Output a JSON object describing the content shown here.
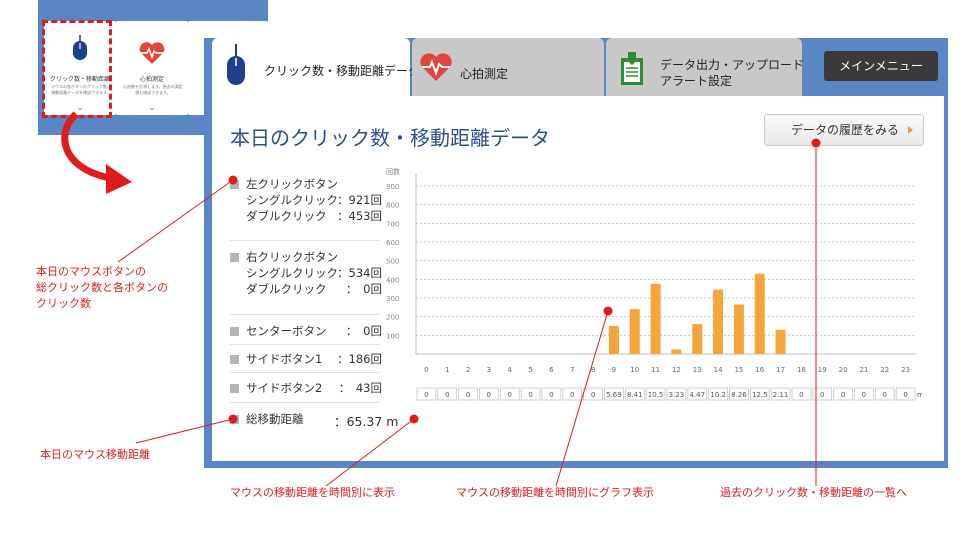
{
  "mini": {
    "cards": [
      {
        "title": "クリック数・移動距離",
        "desc": "マウスの各ボタンのクリック数、移動距離データを確認できます。"
      },
      {
        "title": "心拍測定",
        "desc": "心拍数を計測します。過去の測定値も確認できます。"
      },
      {
        "title": "",
        "desc": ""
      }
    ]
  },
  "tabs": [
    {
      "label": "クリック数・移動距離データ",
      "icon": "mouse-icon"
    },
    {
      "label": "心拍測定",
      "icon": "heart-pulse-icon"
    },
    {
      "label_line1": "データ出力・アップロード",
      "label_line2": "アラート設定",
      "icon": "document-download-icon"
    }
  ],
  "menu_button": "メインメニュー",
  "page_title": "本日のクリック数・移動距離データ",
  "history_button": "データの履歴をみる",
  "stats": {
    "left_button": {
      "label": "左クリックボタン",
      "single_label": "シングルクリック",
      "single_value": "：921回",
      "double_label": "ダブルクリック",
      "double_value": "：453回"
    },
    "right_button": {
      "label": "右クリックボタン",
      "single_label": "シングルクリック",
      "single_value": "：534回",
      "double_label": "ダブルクリック",
      "double_value": "：　0回"
    },
    "center_button": {
      "label": "センターボタン",
      "value": "：　0回"
    },
    "side_button1": {
      "label": "サイドボタン1",
      "value": "：186回"
    },
    "side_button2": {
      "label": "サイドボタン2",
      "value": "：　43回"
    },
    "total_distance": {
      "label": "総移動距離",
      "value": "：65.37 m"
    }
  },
  "chart_data": {
    "type": "bar",
    "ylabel": "回数",
    "ylim": [
      0,
      900
    ],
    "yticks": [
      100,
      200,
      300,
      400,
      500,
      600,
      700,
      800,
      900
    ],
    "categories": [
      "0",
      "1",
      "2",
      "3",
      "4",
      "5",
      "6",
      "7",
      "8",
      "9",
      "10",
      "11",
      "12",
      "13",
      "14",
      "15",
      "16",
      "17",
      "18",
      "19",
      "20",
      "21",
      "22",
      "23"
    ],
    "values": [
      0,
      0,
      0,
      0,
      0,
      0,
      0,
      0,
      0,
      150,
      240,
      375,
      25,
      160,
      345,
      265,
      430,
      130,
      0,
      0,
      0,
      0,
      0,
      0
    ],
    "bar_color": "#f5a53a",
    "distance_row": [
      "0",
      "0",
      "0",
      "0",
      "0",
      "0",
      "0",
      "0",
      "0",
      "5.69",
      "8.41",
      "10.5",
      "3.23",
      "4.47",
      "10.2",
      "8.26",
      "12.5",
      "2.11",
      "0",
      "0",
      "0",
      "0",
      "0",
      "0"
    ],
    "distance_unit": "m/h"
  },
  "annotations": {
    "mouse_buttons_line1": "本日のマウスボタンの",
    "mouse_buttons_line2": "総クリック数と各ボタンの",
    "mouse_buttons_line3": "クリック数",
    "mouse_distance": "本日のマウス移動距離",
    "distance_hourly": "マウスの移動距離を時間別に表示",
    "distance_graph": "マウスの移動距離を時間別にグラフ表示",
    "history_list": "過去のクリック数・移動距離の一覧へ"
  },
  "colors": {
    "window_blue": "#5b86c4",
    "title_blue": "#2a4f8a",
    "accent_red": "#e01b1b",
    "bar_orange": "#f5a53a"
  }
}
